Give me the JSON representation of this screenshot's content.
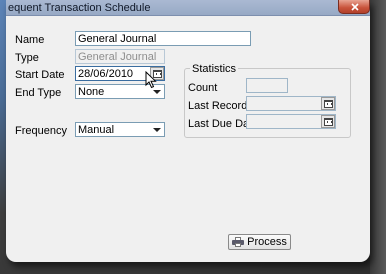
{
  "window": {
    "title": "equent Transaction Schedule"
  },
  "form": {
    "name_label": "Name",
    "name_value": "General Journal",
    "type_label": "Type",
    "type_value": "General Journal",
    "start_date_label": "Start Date",
    "start_date_value": "28/06/2010",
    "end_type_label": "End Type",
    "end_type_value": "None",
    "frequency_label": "Frequency",
    "frequency_value": "Manual"
  },
  "statistics": {
    "legend": "Statistics",
    "count_label": "Count",
    "count_value": "",
    "last_recorded_label": "Last Recorded",
    "last_recorded_value": "",
    "last_due_date_label": "Last Due Date",
    "last_due_date_value": ""
  },
  "actions": {
    "process_label": "Process"
  },
  "icons": {
    "close": "close-icon",
    "calendar": "calendar-icon",
    "dropdown": "chevron-down-icon",
    "process": "printer-icon",
    "cursor": "mouse-pointer-icon"
  }
}
